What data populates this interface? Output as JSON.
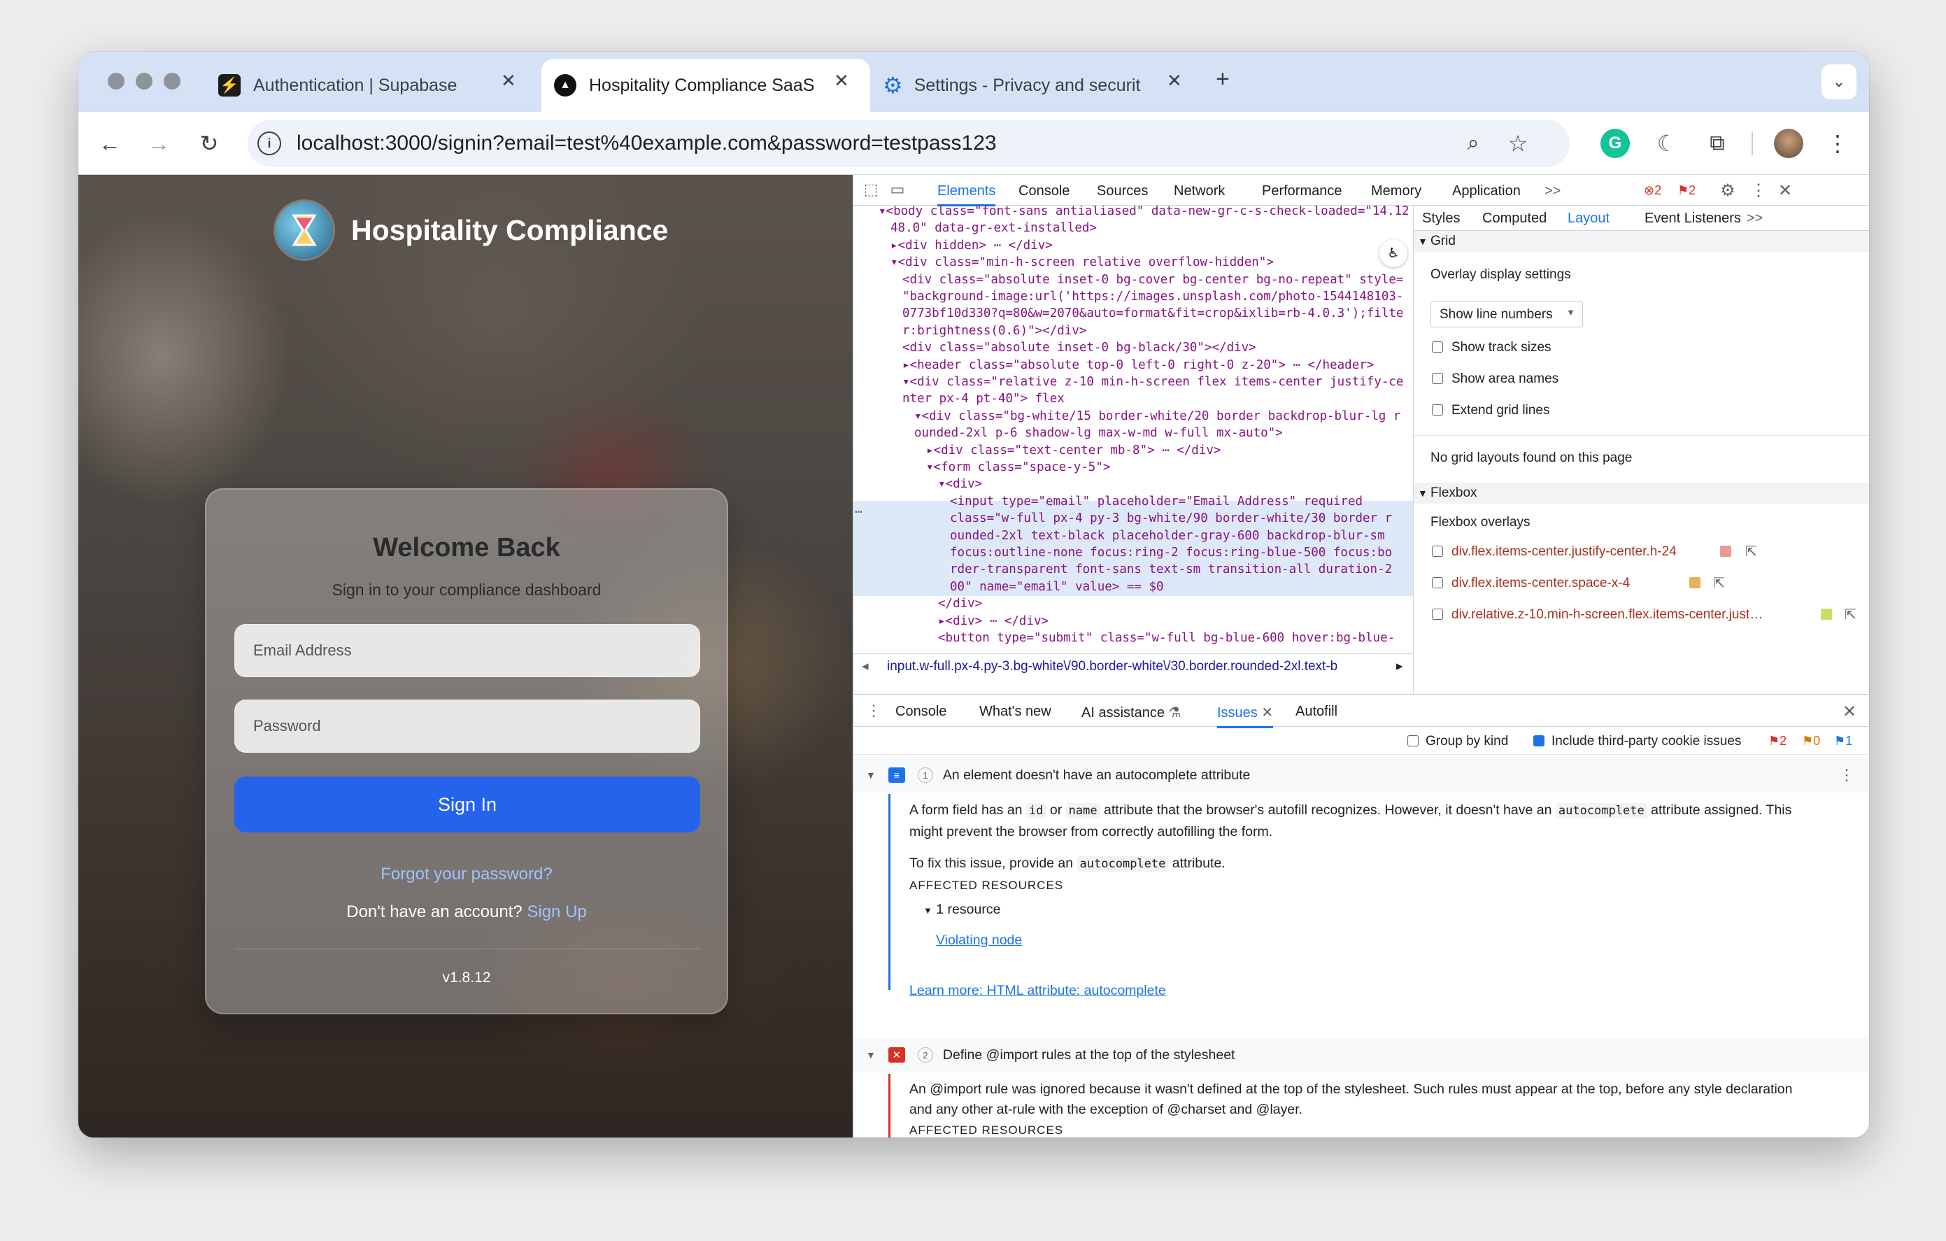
{
  "browser": {
    "tabs": [
      {
        "title": "Authentication | Supabase",
        "icon": "supabase-icon"
      },
      {
        "title": "Hospitality Compliance SaaS",
        "icon": "nextjs-icon"
      },
      {
        "title": "Settings - Privacy and securit",
        "icon": "gear-icon"
      }
    ],
    "url": "localhost:3000/signin?email=test%40example.com&password=testpass123"
  },
  "page": {
    "brand": "Hospitality Compliance",
    "welcome": "Welcome Back",
    "subtitle": "Sign in to your compliance dashboard",
    "email_placeholder": "Email Address",
    "password_placeholder": "Password",
    "sign_in": "Sign In",
    "forgot": "Forgot your password?",
    "no_account": "Don't have an account?",
    "sign_up": "Sign Up",
    "version": "v1.8.12"
  },
  "devtools": {
    "tabs": [
      "Elements",
      "Console",
      "Sources",
      "Network",
      "Performance",
      "Memory",
      "Application",
      ">>"
    ],
    "error_count": "2",
    "issue_count": "2",
    "elements_lines": [
      {
        "indent": 0,
        "text": "▾<body class=\"font-sans antialiased\" data-new-gr-c-s-check-loaded=\"14.12"
      },
      {
        "indent": 1,
        "text": "48.0\" data-gr-ext-installed>"
      },
      {
        "indent": 1,
        "text": "▸<div hidden> ⋯ </div>"
      },
      {
        "indent": 1,
        "text": "▾<div class=\"min-h-screen relative overflow-hidden\">"
      },
      {
        "indent": 2,
        "text": "<div class=\"absolute inset-0 bg-cover bg-center bg-no-repeat\" style="
      },
      {
        "indent": 2,
        "text": "\"background-image:url('https://images.unsplash.com/photo-1544148103-"
      },
      {
        "indent": 2,
        "text": "0773bf10d330?q=80&w=2070&auto=format&fit=crop&ixlib=rb-4.0.3');filte"
      },
      {
        "indent": 2,
        "text": "r:brightness(0.6)\"></div>"
      },
      {
        "indent": 2,
        "text": "<div class=\"absolute inset-0 bg-black/30\"></div>"
      },
      {
        "indent": 2,
        "text": "▸<header class=\"absolute top-0 left-0 right-0 z-20\"> ⋯ </header>"
      },
      {
        "indent": 2,
        "text": "▾<div class=\"relative z-10 min-h-screen flex items-center justify-ce"
      },
      {
        "indent": 2,
        "text": "nter px-4 pt-40\"> flex"
      },
      {
        "indent": 3,
        "text": "▾<div class=\"bg-white/15 border-white/20 border backdrop-blur-lg r"
      },
      {
        "indent": 3,
        "text": "ounded-2xl p-6 shadow-lg max-w-md w-full mx-auto\">"
      },
      {
        "indent": 4,
        "text": "▸<div class=\"text-center mb-8\"> ⋯ </div>"
      },
      {
        "indent": 4,
        "text": "▾<form class=\"space-y-5\">"
      },
      {
        "indent": 5,
        "text": "▾<div>"
      },
      {
        "indent": 6,
        "text": "<input type=\"email\" placeholder=\"Email Address\" required"
      },
      {
        "indent": 6,
        "text": "class=\"w-full px-4 py-3 bg-white/90 border-white/30 border r"
      },
      {
        "indent": 6,
        "text": "ounded-2xl text-black placeholder-gray-600 backdrop-blur-sm"
      },
      {
        "indent": 6,
        "text": "focus:outline-none focus:ring-2 focus:ring-blue-500 focus:bo"
      },
      {
        "indent": 6,
        "text": "rder-transparent font-sans text-sm transition-all duration-2"
      },
      {
        "indent": 6,
        "text": "00\" name=\"email\" value> == $0"
      },
      {
        "indent": 5,
        "text": "</div>"
      },
      {
        "indent": 5,
        "text": "▸<div> ⋯ </div>"
      },
      {
        "indent": 5,
        "text": "<button type=\"submit\" class=\"w-full bg-blue-600 hover:bg-blue-"
      }
    ],
    "breadcrumb": "input.w-full.px-4.py-3.bg-white\\/90.border-white\\/30.border.rounded-2xl.text-b",
    "side_tabs": [
      "Styles",
      "Computed",
      "Layout",
      "Event Listeners",
      ">>"
    ],
    "layout": {
      "grid_section": "Grid",
      "overlay_title": "Overlay display settings",
      "line_numbers_select": "Show line numbers",
      "options": [
        "Show track sizes",
        "Show area names",
        "Extend grid lines"
      ],
      "no_grid": "No grid layouts found on this page",
      "flexbox_section": "Flexbox",
      "flex_overlays_title": "Flexbox overlays",
      "flex_items": [
        {
          "label": "div.flex.items-center.justify-center.h-24",
          "color": "#e8999a"
        },
        {
          "label": "div.flex.items-center.space-x-4",
          "color": "#e8b25a"
        },
        {
          "label": "div.relative.z-10.min-h-screen.flex.items-center.just…",
          "color": "#c8e063"
        }
      ]
    },
    "drawer_tabs": [
      "Console",
      "What's new",
      "AI assistance",
      "Issues",
      "Autofill"
    ],
    "group_by_kind": "Group by kind",
    "include_third_party": "Include third-party cookie issues",
    "counts": {
      "errors": "2",
      "warnings": "0",
      "info": "1"
    },
    "issues": [
      {
        "number": "1",
        "title": "An element doesn't have an autocomplete attribute",
        "p1a": "A form field has an",
        "code_id": "id",
        "p1b": "or",
        "code_name": "name",
        "p1c": "attribute that the browser's autofill recognizes. However, it doesn't have an",
        "code_auto": "autocomplete",
        "p1d": "attribute assigned. This",
        "p1e": "might prevent the browser from correctly autofilling the form.",
        "fix_a": "To fix this issue, provide an",
        "fix_b": "attribute.",
        "affected": "AFFECTED RESOURCES",
        "resource": "1 resource",
        "violating": "Violating node",
        "learn": "Learn more: HTML attribute: autocomplete"
      },
      {
        "number": "2",
        "title": "Define @import rules at the top of the stylesheet",
        "p1": "An @import rule was ignored because it wasn't defined at the top of the stylesheet. Such rules must appear at the top, before any style declaration",
        "p2": "and any other at-rule with the exception of @charset and @layer.",
        "affected": "AFFECTED RESOURCES"
      }
    ]
  }
}
